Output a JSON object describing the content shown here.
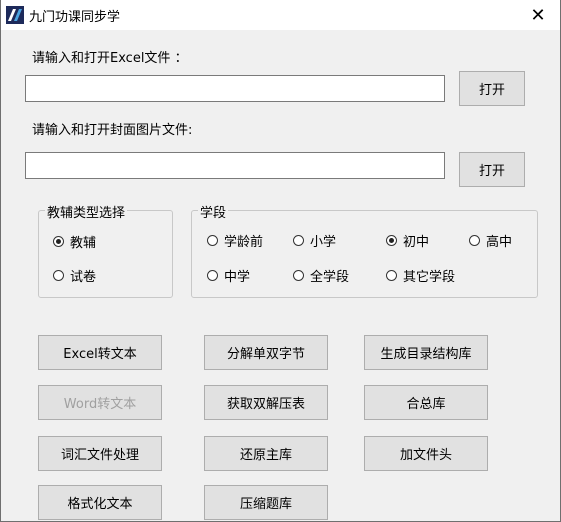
{
  "window": {
    "title": "九门功课同步学",
    "close_glyph": "✕",
    "icon": "app-logo-icon"
  },
  "excel": {
    "label": "请输入和打开Excel文件 ：",
    "value": "",
    "open_label": "打开"
  },
  "cover": {
    "label": "请输入和打开封面图片文件:",
    "value": "",
    "open_label": "打开"
  },
  "type_group": {
    "title": "教辅类型选择",
    "options": [
      {
        "label": "教辅",
        "checked": true
      },
      {
        "label": "试卷",
        "checked": false
      }
    ]
  },
  "stage_group": {
    "title": "学段",
    "options": [
      {
        "label": "学龄前",
        "checked": false
      },
      {
        "label": "小学",
        "checked": false
      },
      {
        "label": "初中",
        "checked": true
      },
      {
        "label": "高中",
        "checked": false
      },
      {
        "label": "中学",
        "checked": false
      },
      {
        "label": "全学段",
        "checked": false
      },
      {
        "label": "其它学段",
        "checked": false
      }
    ]
  },
  "buttons": {
    "excel_to_text": "Excel转文本",
    "split_char": "分解单双字节",
    "gen_toc_db": "生成目录结构库",
    "word_to_text": "Word转文本",
    "get_double_table": "获取双解压表",
    "merge_db": "合总库",
    "vocab_process": "词汇文件处理",
    "restore_main_db": "还原主库",
    "add_file_header": "加文件头",
    "format_text": "格式化文本",
    "compress_db": "压缩题库"
  }
}
